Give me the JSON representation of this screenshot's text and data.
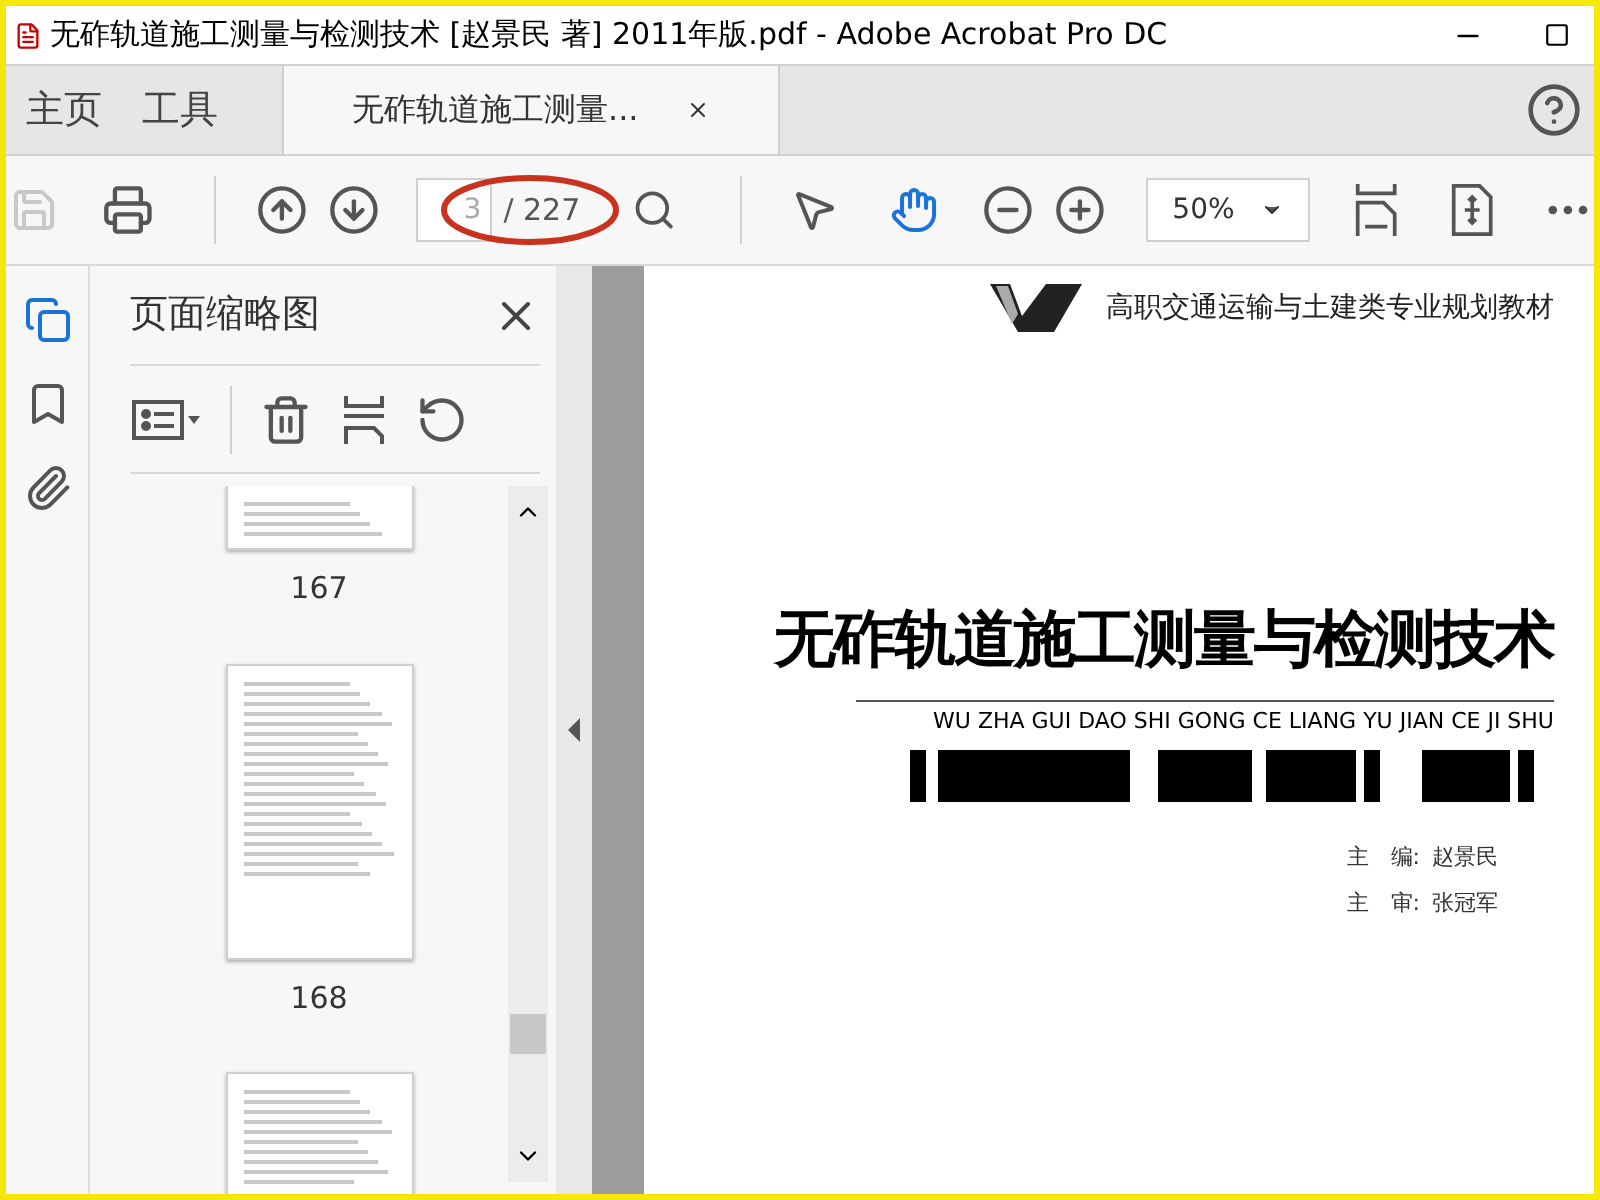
{
  "window": {
    "title": "无砟轨道施工测量与检测技术 [赵景民 著] 2011年版.pdf - Adobe Acrobat Pro DC"
  },
  "tabs": [
    {
      "kind": "nav",
      "label": "主页",
      "selected": false
    },
    {
      "kind": "nav",
      "label": "工具",
      "selected": false
    },
    {
      "kind": "document",
      "label": "无砟轨道施工测量...",
      "selected": true
    }
  ],
  "toolbar": {
    "save_disabled": true,
    "page_number": "3",
    "page_count": "/ 227",
    "zoom": "50%",
    "tools": [
      {
        "kind": "select",
        "selected": false
      },
      {
        "kind": "hand",
        "selected": true
      }
    ]
  },
  "rail": [
    {
      "kind": "pages",
      "selected": true
    },
    {
      "kind": "bookmarks",
      "selected": false
    },
    {
      "kind": "attachments",
      "selected": false
    }
  ],
  "panel": {
    "title": "页面缩略图",
    "thumbnails": [
      {
        "kind": "partial-top",
        "label": "167"
      },
      {
        "kind": "full",
        "label": "168"
      },
      {
        "kind": "partial-bottom"
      }
    ]
  },
  "page": {
    "series": "高职交通运输与土建类专业规划教材",
    "title": "无砟轨道施工测量与检测技术",
    "pinyin": "WU ZHA GUI DAO SHI GONG CE LIANG YU JIAN CE JI SHU",
    "credits": [
      {
        "role": "主　编:",
        "name": "赵景民"
      },
      {
        "role": "主　审:",
        "name": "张冠军"
      }
    ]
  }
}
